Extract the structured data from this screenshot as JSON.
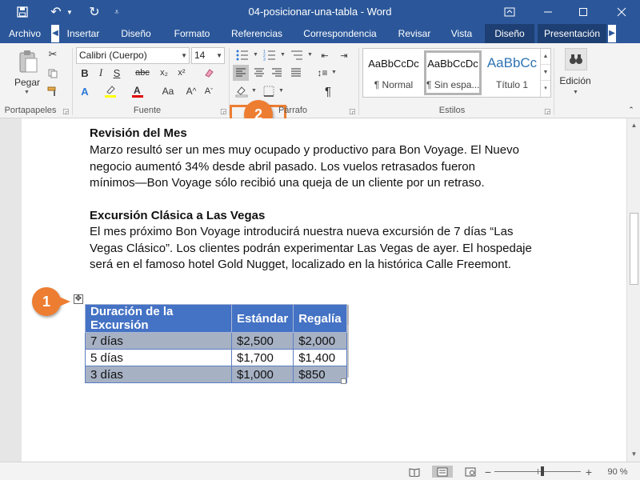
{
  "window": {
    "title": "04-posicionar-una-tabla - Word",
    "qat": {
      "save_icon": "save-icon",
      "undo_icon": "undo-icon",
      "redo_icon": "redo-icon"
    }
  },
  "tabs": [
    "Archivo",
    "Insertar",
    "Diseño",
    "Formato",
    "Referencias",
    "Correspondencia",
    "Revisar",
    "Vista",
    "Diseño",
    "Presentación"
  ],
  "ribbon": {
    "clipboard": {
      "paste_label": "Pegar",
      "group_label": "Portapapeles"
    },
    "font": {
      "font_name": "Calibri (Cuerpo)",
      "font_size": "14",
      "group_label": "Fuente"
    },
    "paragraph": {
      "group_label": "Párrafo"
    },
    "styles": {
      "group_label": "Estilos",
      "items": [
        {
          "sample": "AaBbCcDc",
          "name": "¶ Normal"
        },
        {
          "sample": "AaBbCcDc",
          "name": "¶ Sin espa..."
        },
        {
          "sample": "AaBbCc",
          "name": "Título 1"
        }
      ]
    },
    "editing": {
      "label": "Edición"
    }
  },
  "document": {
    "paragraphs": [
      {
        "text": "Revisión del Mes",
        "bold": true
      },
      {
        "text": "Marzo resultó ser un mes muy ocupado y productivo para Bon Voyage. El Nuevo",
        "bold": false
      },
      {
        "text": "negocio aumentó 34% desde abril pasado. Los vuelos retrasados fueron",
        "bold": false
      },
      {
        "text": "mínimos—Bon Voyage sólo recibió una queja de un cliente por un retraso.",
        "bold": false
      },
      {
        "text": "Excursión Clásica a Las Vegas",
        "bold": true
      },
      {
        "text": "El mes próximo Bon Voyage introducirá nuestra nueva excursión de 7 días “Las",
        "bold": false
      },
      {
        "text": "Vegas Clásico”. Los clientes podrán experimentar Las Vegas de ayer. El hospedaje",
        "bold": false
      },
      {
        "text": "será en el famoso hotel Gold Nugget, localizado en la histórica Calle Freemont.",
        "bold": false
      }
    ],
    "table": {
      "headers": [
        "Duración de la Excursión",
        "Estándar",
        "Regalía"
      ],
      "rows": [
        [
          "7 días",
          "$2,500",
          "$2,000"
        ],
        [
          "5 días",
          "$1,700",
          "$1,400"
        ],
        [
          "3 días",
          "$1,000",
          "$850"
        ]
      ]
    }
  },
  "callouts": [
    "1",
    "2"
  ],
  "status": {
    "zoom": "90 %"
  },
  "colors": {
    "accent": "#2b579a",
    "callout": "#ed7d31",
    "table_header": "#4472c4"
  }
}
